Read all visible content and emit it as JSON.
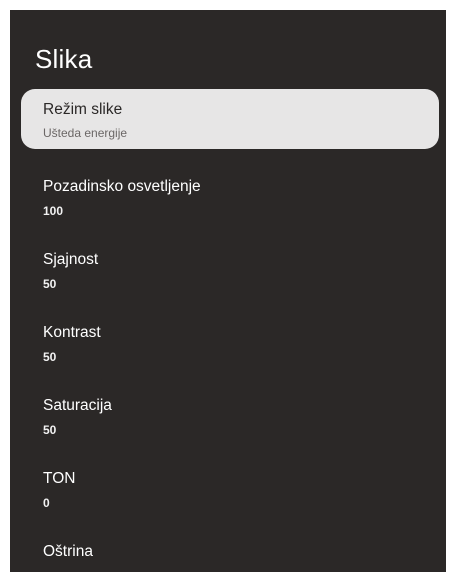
{
  "page": {
    "title": "Slika"
  },
  "menu": {
    "items": [
      {
        "label": "Režim slike",
        "value": "Ušteda energije"
      },
      {
        "label": "Pozadinsko osvetljenje",
        "value": "100"
      },
      {
        "label": "Sjajnost",
        "value": "50"
      },
      {
        "label": "Kontrast",
        "value": "50"
      },
      {
        "label": "Saturacija",
        "value": "50"
      },
      {
        "label": "TON",
        "value": "0"
      },
      {
        "label": "Oštrina",
        "value": ""
      }
    ]
  },
  "colors": {
    "panel_background": "#2b2827",
    "selected_background": "#e7e6e6",
    "text_primary": "#ffffff"
  }
}
